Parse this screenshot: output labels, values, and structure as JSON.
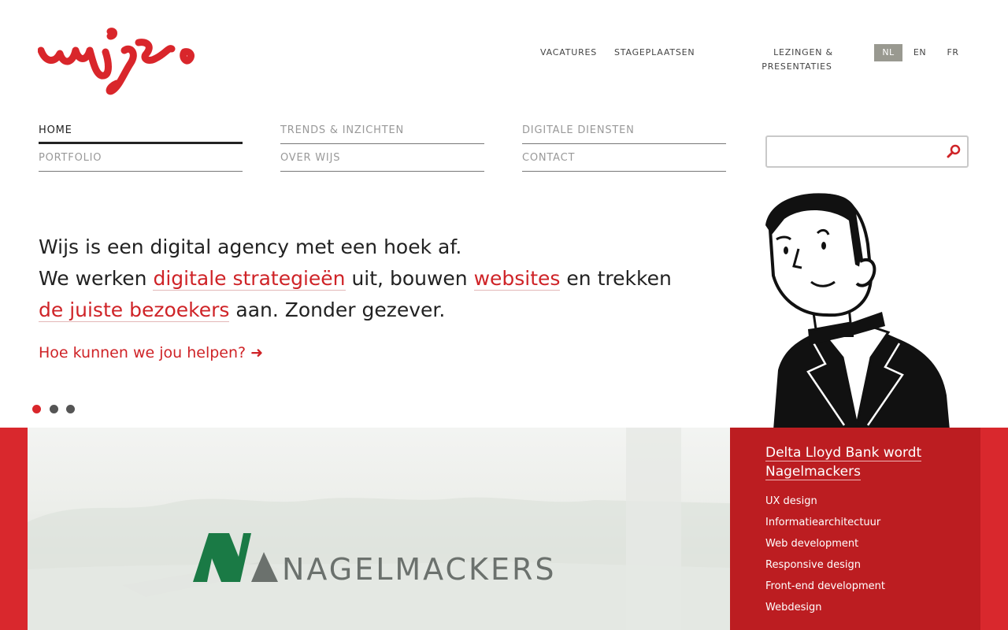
{
  "header": {
    "logo_text": "wijs.",
    "top_links": [
      "VACATURES",
      "STAGEPLAATSEN",
      "LEZINGEN &",
      "PRESENTATIES"
    ],
    "languages": [
      "NL",
      "EN",
      "FR"
    ],
    "active_language": "NL"
  },
  "nav": {
    "items": [
      "HOME",
      "TRENDS & INZICHTEN",
      "DIGITALE DIENSTEN",
      "PORTFOLIO",
      "OVER WIJS",
      "CONTACT"
    ],
    "active": "HOME"
  },
  "search": {
    "value": "",
    "placeholder": "",
    "icon": "search-icon"
  },
  "hero": {
    "line1": "Wijs is een digital agency met een hoek af.",
    "l2_a": "We werken ",
    "l2_link1": "digitale strategieën",
    "l2_b": " uit, bouwen ",
    "l2_link2": "websites",
    "l2_c": " en trekken ",
    "l2_link3": "de juiste bezoekers",
    "l2_d": " aan. Zonder gezever.",
    "cta": "Hoe kunnen we jou helpen? ➜"
  },
  "slider": {
    "count": 3,
    "active_index": 0
  },
  "feature": {
    "brand": "NAGELMACKERS",
    "title": "Delta Lloyd Bank wordt Nagelmackers",
    "services": [
      "UX design",
      "Informatiearchitectuur",
      "Web development",
      "Responsive design",
      "Front-end development",
      "Webdesign"
    ]
  },
  "colors": {
    "accent": "#d9282d",
    "panel": "#bc1d21",
    "brand_green": "#1a7a45",
    "brand_grey": "#6b716d"
  }
}
